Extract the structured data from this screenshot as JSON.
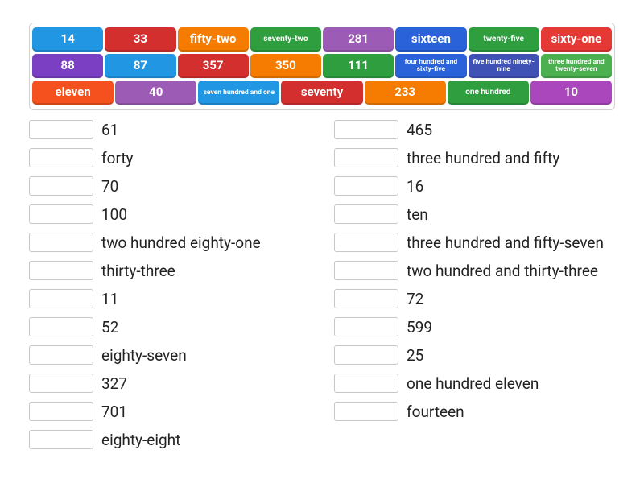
{
  "chart_data": {
    "type": "table",
    "title": "Number-word matching exercise",
    "bank_tiles": [
      "14",
      "33",
      "fifty-two",
      "seventy-two",
      "281",
      "sixteen",
      "twenty-five",
      "sixty-one",
      "88",
      "87",
      "357",
      "350",
      "111",
      "four hundred and sixty-five",
      "five hundred ninety-nine",
      "three hundred and twenty-seven",
      "eleven",
      "40",
      "seven hundred and one",
      "seventy",
      "233",
      "one hundred",
      "10"
    ],
    "left_prompts": [
      "61",
      "forty",
      "70",
      "100",
      "two hundred eighty-one",
      "thirty-three",
      "11",
      "52",
      "eighty-seven",
      "327",
      "701",
      "eighty-eight"
    ],
    "right_prompts": [
      "465",
      "three hundred and fifty",
      "16",
      "ten",
      "three hundred and fifty-seven",
      "two hundred and thirty-three",
      "72",
      "599",
      "25",
      "one hundred eleven",
      "fourteen"
    ]
  },
  "bank": {
    "rows": [
      [
        {
          "label": "14",
          "color": "#2196e3",
          "size": "normal"
        },
        {
          "label": "33",
          "color": "#d32f2f",
          "size": "normal"
        },
        {
          "label": "fifty-two",
          "color": "#f57c00",
          "size": "normal"
        },
        {
          "label": "seventy-two",
          "color": "#2e9e3f",
          "size": "small"
        },
        {
          "label": "281",
          "color": "#9c5bb5",
          "size": "normal"
        },
        {
          "label": "sixteen",
          "color": "#2962d9",
          "size": "normal"
        },
        {
          "label": "twenty-five",
          "color": "#2e9e3f",
          "size": "small"
        },
        {
          "label": "sixty-one",
          "color": "#e53935",
          "size": "normal"
        }
      ],
      [
        {
          "label": "88",
          "color": "#7b3fc4",
          "size": "normal"
        },
        {
          "label": "87",
          "color": "#2196e3",
          "size": "normal"
        },
        {
          "label": "357",
          "color": "#d32f2f",
          "size": "normal"
        },
        {
          "label": "350",
          "color": "#f57c00",
          "size": "normal"
        },
        {
          "label": "111",
          "color": "#2e9e3f",
          "size": "normal"
        },
        {
          "label": "four hundred and sixty-five",
          "color": "#2962d9",
          "size": "xsmall"
        },
        {
          "label": "five hundred ninety-nine",
          "color": "#3f51b5",
          "size": "xsmall"
        },
        {
          "label": "three hundred and twenty-seven",
          "color": "#4caf50",
          "size": "xsmall"
        }
      ],
      [
        {
          "label": "eleven",
          "color": "#f4511e",
          "size": "normal"
        },
        {
          "label": "40",
          "color": "#9c5bb5",
          "size": "normal"
        },
        {
          "label": "seven hundred and one",
          "color": "#2196e3",
          "size": "xsmall"
        },
        {
          "label": "seventy",
          "color": "#d32f2f",
          "size": "normal"
        },
        {
          "label": "233",
          "color": "#f57c00",
          "size": "normal"
        },
        {
          "label": "one hundred",
          "color": "#2e9e3f",
          "size": "small"
        },
        {
          "label": "10",
          "color": "#ab47bc",
          "size": "normal"
        }
      ]
    ]
  },
  "answers": {
    "left": [
      {
        "label": "61"
      },
      {
        "label": "forty"
      },
      {
        "label": "70"
      },
      {
        "label": "100"
      },
      {
        "label": "two hundred eighty-one"
      },
      {
        "label": "thirty-three"
      },
      {
        "label": "11"
      },
      {
        "label": "52"
      },
      {
        "label": "eighty-seven"
      },
      {
        "label": "327"
      },
      {
        "label": "701"
      },
      {
        "label": "eighty-eight"
      }
    ],
    "right": [
      {
        "label": "465"
      },
      {
        "label": "three hundred and fifty"
      },
      {
        "label": "16"
      },
      {
        "label": "ten"
      },
      {
        "label": "three hundred and fifty-seven"
      },
      {
        "label": "two hundred and thirty-three"
      },
      {
        "label": "72"
      },
      {
        "label": "599"
      },
      {
        "label": "25"
      },
      {
        "label": "one hundred eleven"
      },
      {
        "label": "fourteen"
      }
    ]
  }
}
